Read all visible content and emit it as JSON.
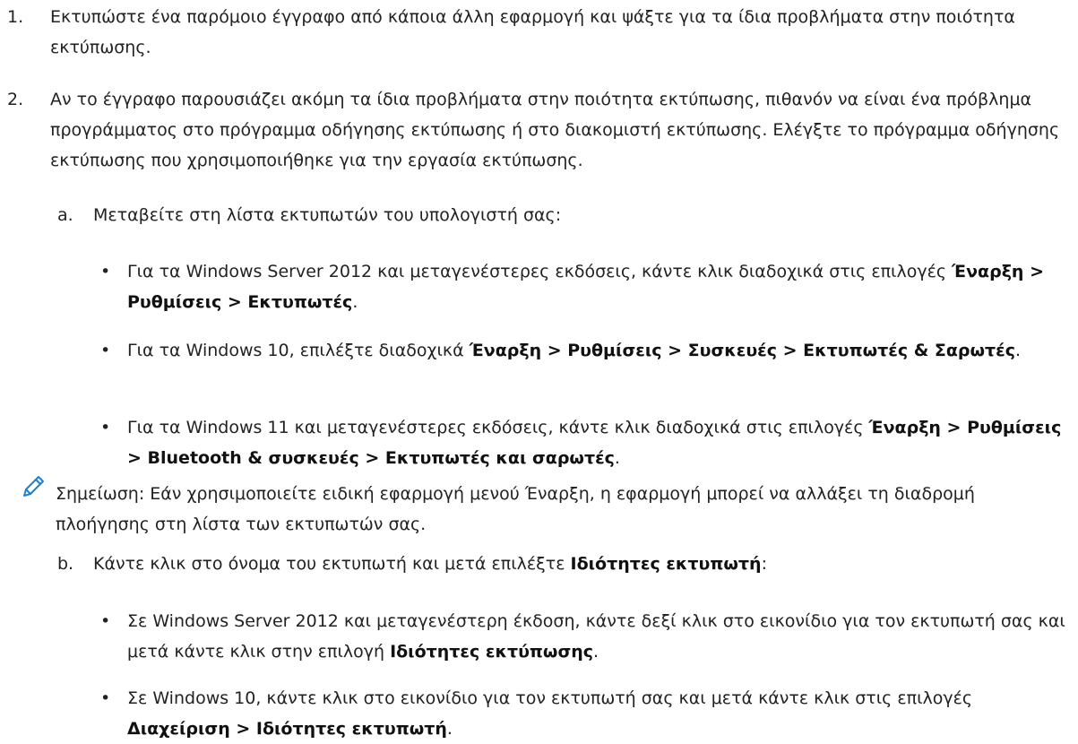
{
  "steps": [
    {
      "number": "1.",
      "text": "Εκτυπώστε ένα παρόμοιο έγγραφο από κάποια άλλη εφαρμογή και ψάξτε για τα ίδια προβλήματα στην ποιότητα εκτύπωσης."
    },
    {
      "number": "2.",
      "text": "Αν το έγγραφο παρουσιάζει ακόμη τα ίδια προβλήματα στην ποιότητα εκτύπωσης, πιθανόν να είναι ένα πρόβλημα προγράμματος στο πρόγραμμα οδήγησης εκτύπωσης ή στο διακομιστή εκτύπωσης. Ελέγξτε το πρόγραμμα οδήγησης εκτύπωσης που χρησιμοποιήθηκε για την εργασία εκτύπωσης."
    }
  ],
  "substep_a": {
    "letter": "a.",
    "text": "Μεταβείτε στη λίστα εκτυπωτών του υπολογιστή σας:",
    "bullets": [
      {
        "marker": "•",
        "prefix": "Για τα Windows Server 2012 και μεταγενέστερες εκδόσεις, κάντε κλικ διαδοχικά στις επιλογές ",
        "bold": "Έναρξη > Ρυθμίσεις > Εκτυπωτές",
        "suffix": "."
      },
      {
        "marker": "•",
        "prefix": "Για τα Windows 10, επιλέξτε διαδοχικά ",
        "bold": "Έναρξη > Ρυθμίσεις > Συσκευές > Εκτυπωτές & Σαρωτές",
        "suffix": "."
      },
      {
        "marker": "•",
        "prefix": "Για τα Windows 11 και μεταγενέστερες εκδόσεις, κάντε κλικ διαδοχικά στις επιλογές ",
        "bold": "Έναρξη > Ρυθμίσεις > Bluetooth & συσκευές > Εκτυπωτές και σαρωτές",
        "suffix": "."
      }
    ]
  },
  "note": {
    "icon": "pencil-icon",
    "icon_color": "#1f7fd0",
    "text": "Σημείωση: Εάν χρησιμοποιείτε ειδική εφαρμογή μενού Έναρξη, η εφαρμογή μπορεί να αλλάξει τη διαδρομή πλοήγησης στη λίστα των εκτυπωτών σας."
  },
  "substep_b": {
    "letter": "b.",
    "prefix": "Κάντε κλικ στο όνομα του εκτυπωτή και μετά επιλέξτε ",
    "bold": "Ιδιότητες εκτυπωτή",
    "suffix": ":",
    "bullets": [
      {
        "marker": "•",
        "prefix": "Σε Windows Server 2012 και μεταγενέστερη έκδοση, κάντε δεξί κλικ στο εικονίδιο για τον εκτυπωτή σας και μετά κάντε κλικ στην επιλογή ",
        "bold": "Ιδιότητες εκτύπωσης",
        "suffix": "."
      },
      {
        "marker": "•",
        "prefix": "Σε Windows 10, κάντε κλικ στο εικονίδιο για τον εκτυπωτή σας και μετά κάντε κλικ στις επιλογές ",
        "bold": "Διαχείριση > Ιδιότητες εκτυπωτή",
        "suffix": "."
      }
    ]
  }
}
